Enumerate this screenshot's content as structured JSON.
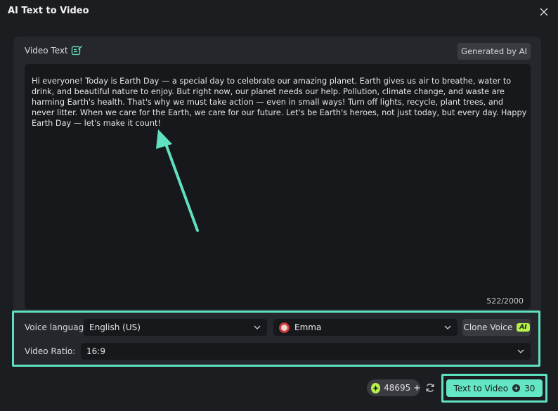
{
  "window": {
    "title": "AI Text to Video"
  },
  "video_text": {
    "label": "Video Text",
    "generated_by_ai_label": "Generated by AI",
    "content": "Hi everyone! Today is Earth Day — a special day to celebrate our amazing planet. Earth gives us air to breathe, water to drink, and beautiful nature to enjoy. But right now, our planet needs our help. Pollution, climate change, and waste are harming Earth's health. That's why we must take action — even in small ways! Turn off lights, recycle, plant trees, and never litter. When we care for the Earth, we care for our future. Let's be Earth's heroes, not just today, but every day. Happy Earth Day — let's make it count!",
    "char_count": "522/2000"
  },
  "voice": {
    "language_label": "Voice language:",
    "language_value": "English (US)",
    "voice_name": "Emma",
    "clone_label": "Clone Voice",
    "clone_badge": "AI"
  },
  "ratio": {
    "label": "Video Ratio:",
    "value": "16:9"
  },
  "footer": {
    "credits": "48695",
    "generate_label": "Text to Video",
    "generate_cost": "30"
  },
  "colors": {
    "accent": "#63e6c4",
    "highlight": "#5fe0c0",
    "badge": "#b6f04a"
  }
}
